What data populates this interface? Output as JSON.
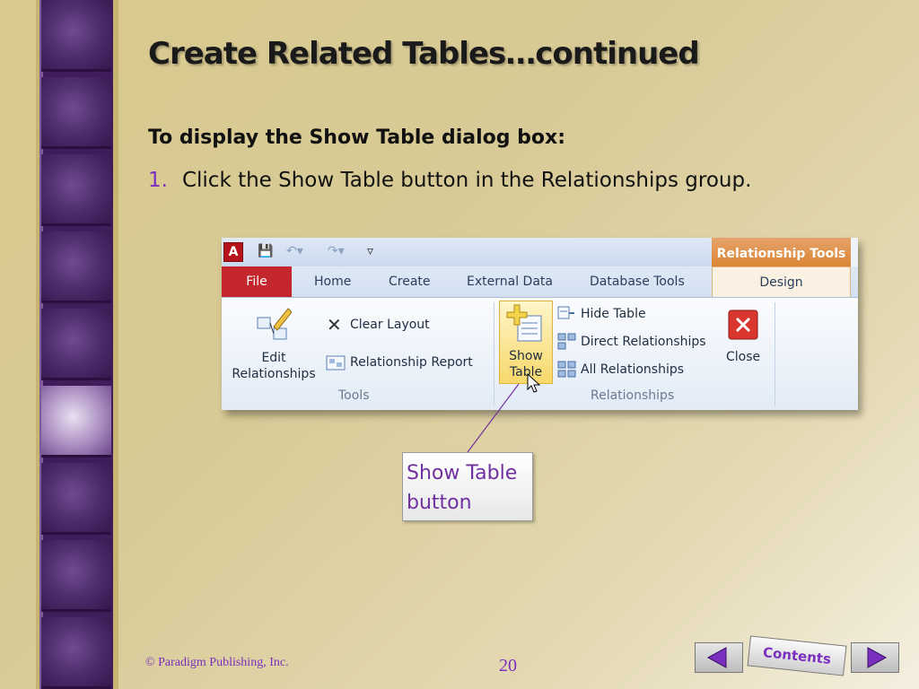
{
  "slide": {
    "title": "Create Related Tables…continued",
    "subtitle": "To display the Show Table dialog box:",
    "step_number": "1.",
    "step_text": "Click the Show Table button in the Relationships group."
  },
  "ribbon": {
    "app_icon": "A",
    "context_header": "Relationship Tools",
    "tabs": [
      "File",
      "Home",
      "Create",
      "External Data",
      "Database Tools",
      "Design"
    ],
    "buttons": {
      "edit_relationships": "Edit\nRelationships",
      "clear_layout": "Clear Layout",
      "relationship_report": "Relationship Report",
      "show_table": "Show\nTable",
      "hide_table": "Hide Table",
      "direct_relationships": "Direct Relationships",
      "all_relationships": "All Relationships",
      "close": "Close"
    },
    "groups": [
      "Tools",
      "Relationships"
    ]
  },
  "callout": {
    "line1": "Show Table",
    "line2": "button"
  },
  "footer": {
    "copyright": "© Paradigm Publishing, Inc.",
    "page_number": "20",
    "contents_label": "Contents"
  },
  "colors": {
    "accent": "#7b2fbf",
    "file_tab": "#c4262e",
    "context_tab": "#d9822f"
  }
}
